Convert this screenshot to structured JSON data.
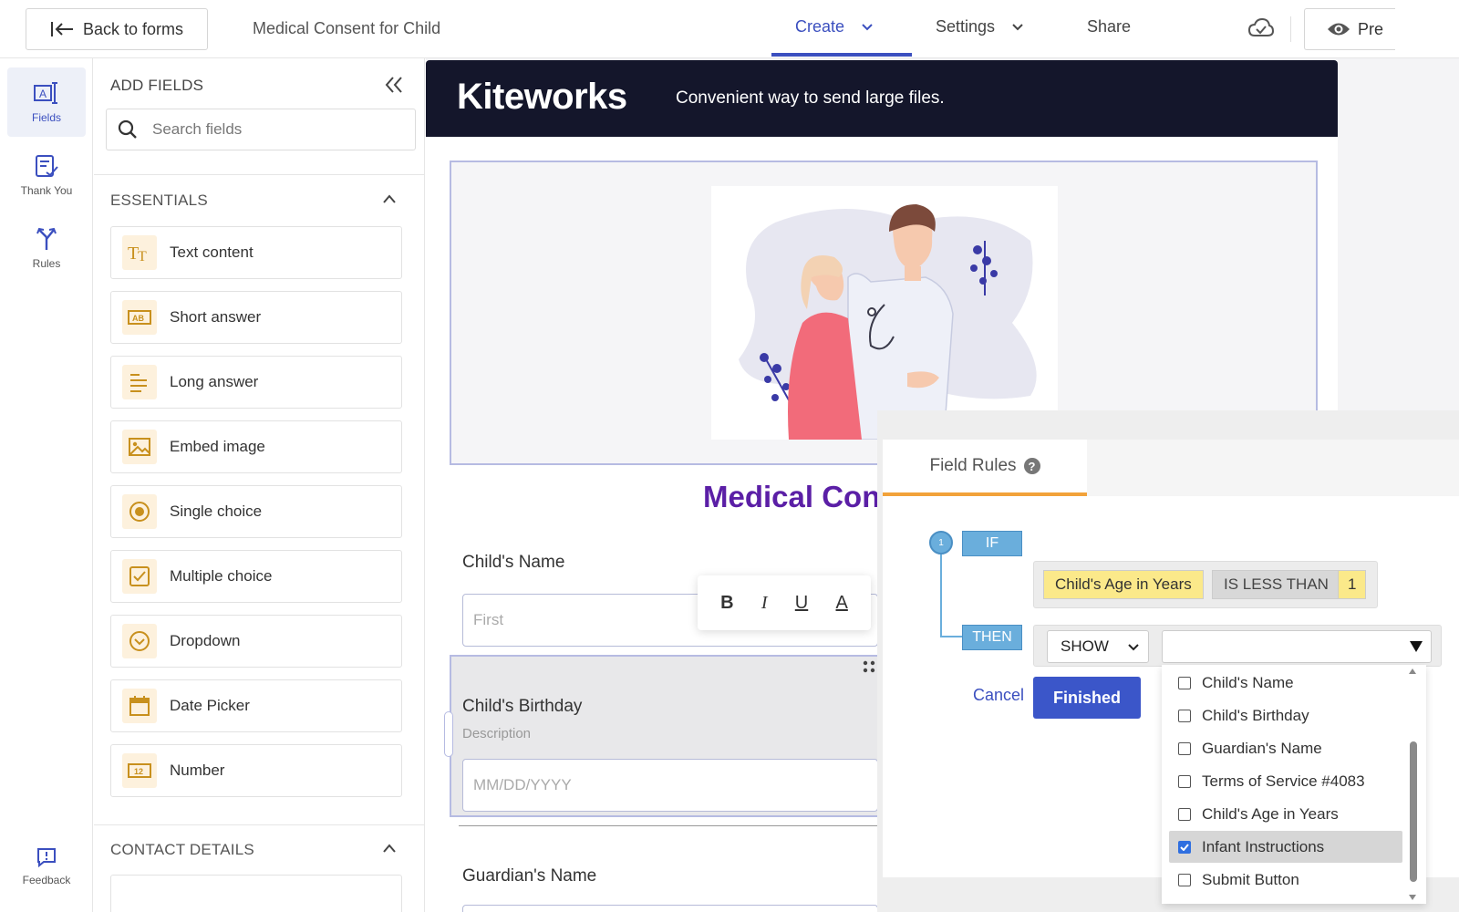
{
  "topbar": {
    "back_label": "Back to forms",
    "form_title": "Medical Consent for Child",
    "nav": {
      "create": "Create",
      "settings": "Settings",
      "share": "Share"
    },
    "preview_label": "Pre"
  },
  "rail": {
    "items": [
      {
        "label": "Fields",
        "icon": "fields-icon",
        "active": true
      },
      {
        "label": "Thank You",
        "icon": "thank-you-icon"
      },
      {
        "label": "Rules",
        "icon": "rules-icon"
      }
    ],
    "feedback": "Feedback"
  },
  "fields_panel": {
    "title": "ADD FIELDS",
    "search_placeholder": "Search fields",
    "essentials_title": "ESSENTIALS",
    "contact_title": "CONTACT DETAILS",
    "fields": [
      {
        "label": "Text content",
        "icon": "text-content-icon"
      },
      {
        "label": "Short answer",
        "icon": "short-answer-icon"
      },
      {
        "label": "Long answer",
        "icon": "long-answer-icon"
      },
      {
        "label": "Embed image",
        "icon": "image-icon"
      },
      {
        "label": "Single choice",
        "icon": "radio-icon"
      },
      {
        "label": "Multiple choice",
        "icon": "checkbox-icon"
      },
      {
        "label": "Dropdown",
        "icon": "dropdown-icon"
      },
      {
        "label": "Date Picker",
        "icon": "calendar-icon"
      },
      {
        "label": "Number",
        "icon": "number-icon"
      }
    ]
  },
  "form": {
    "brand": "Kiteworks",
    "tagline": "Convenient way to send large files.",
    "heading": "Medical Con",
    "child_name_label": "Child's Name",
    "child_name_placeholder": "First",
    "birthday_label": "Child's Birthday",
    "birthday_description": "Description",
    "birthday_placeholder": "MM/DD/YYYY",
    "guardian_label": "Guardian's Name",
    "format_toolbar": {
      "bold": "B",
      "italic": "I",
      "underline": "U",
      "color": "A"
    }
  },
  "rules": {
    "tab_label": "Field Rules",
    "rule_number": "1",
    "if_label": "IF",
    "then_label": "THEN",
    "condition": {
      "field": "Child's Age in Years",
      "operator": "IS LESS THAN",
      "value": "1"
    },
    "action": "SHOW",
    "cancel_label": "Cancel",
    "finished_label": "Finished",
    "options": [
      {
        "label": "Child's Name",
        "checked": false
      },
      {
        "label": "Child's Birthday",
        "checked": false
      },
      {
        "label": "Guardian's Name",
        "checked": false
      },
      {
        "label": "Terms of Service #4083",
        "checked": false
      },
      {
        "label": "Child's Age in Years",
        "checked": false
      },
      {
        "label": "Infant Instructions",
        "checked": true
      },
      {
        "label": "Submit Button",
        "checked": false
      }
    ]
  },
  "colors": {
    "accent": "#3b4fbf",
    "heading": "#5b1fa6",
    "banner": "#14162b",
    "tab_underline": "#f2a23a",
    "chip_yellow": "#fbe98a"
  }
}
